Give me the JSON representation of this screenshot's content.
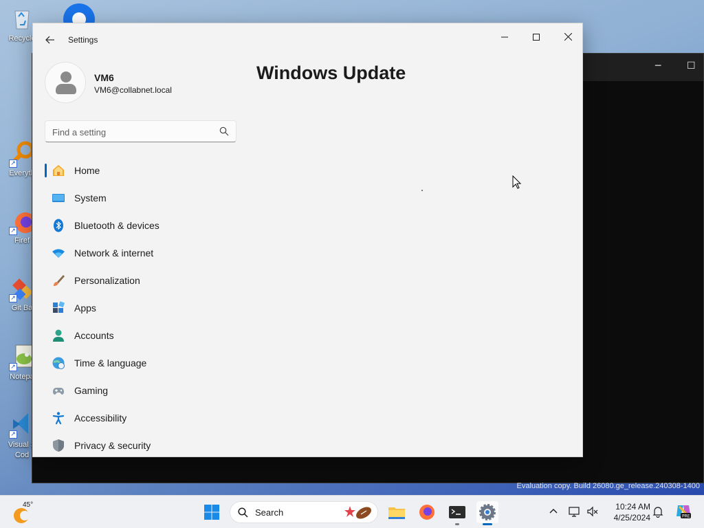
{
  "desktop": {
    "icons": [
      {
        "label": "Recycle"
      },
      {
        "label": "Everyth"
      },
      {
        "label": "Firef"
      },
      {
        "label": "Git Ba"
      },
      {
        "label": "Notepa"
      },
      {
        "label": "Visual S\nCod"
      }
    ],
    "watermark": "Evaluation copy. Build 26080.ge_release.240308-1400"
  },
  "settings": {
    "window_title": "Settings",
    "profile": {
      "name": "VM6",
      "email": "VM6@collabnet.local"
    },
    "search": {
      "placeholder": "Find a setting"
    },
    "nav": [
      {
        "label": "Home",
        "icon": "home-icon"
      },
      {
        "label": "System",
        "icon": "system-icon"
      },
      {
        "label": "Bluetooth & devices",
        "icon": "bluetooth-icon"
      },
      {
        "label": "Network & internet",
        "icon": "wifi-icon"
      },
      {
        "label": "Personalization",
        "icon": "brush-icon"
      },
      {
        "label": "Apps",
        "icon": "apps-icon"
      },
      {
        "label": "Accounts",
        "icon": "accounts-icon"
      },
      {
        "label": "Time & language",
        "icon": "globe-clock-icon"
      },
      {
        "label": "Gaming",
        "icon": "gamepad-icon"
      },
      {
        "label": "Accessibility",
        "icon": "accessibility-icon"
      },
      {
        "label": "Privacy & security",
        "icon": "shield-icon"
      }
    ],
    "active_nav": "Home",
    "page_title": "Windows Update"
  },
  "taskbar": {
    "weather_temp": "45°",
    "search_label": "Search",
    "time": "10:24 AM",
    "date": "4/25/2024"
  },
  "colors": {
    "accent": "#0067c0",
    "window_bg": "#f3f3f3",
    "taskbar_bg": "#eef0f4"
  }
}
